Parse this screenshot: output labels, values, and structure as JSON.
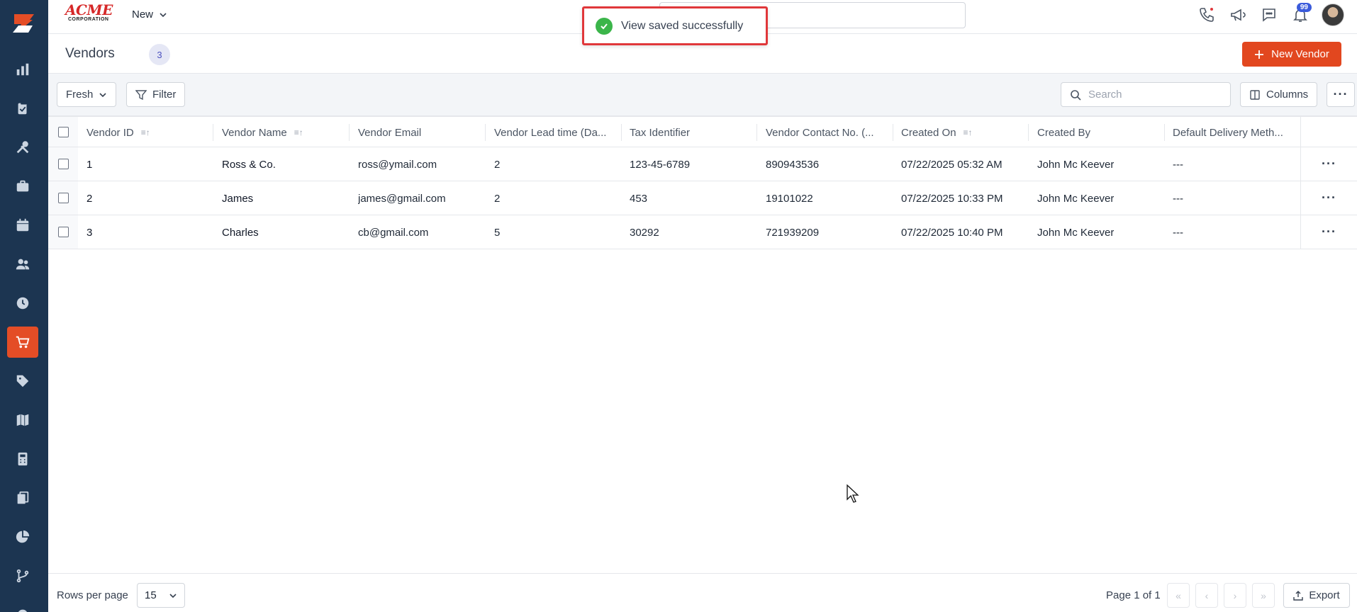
{
  "brand": {
    "name_top": "ACME",
    "name_bottom": "CORPORATION"
  },
  "topbar": {
    "new_label": "New",
    "notification_count": "99"
  },
  "toast": {
    "message": "View saved successfully"
  },
  "page": {
    "title": "Vendors",
    "count": "3",
    "new_button": "New Vendor"
  },
  "toolbar": {
    "view_label": "Fresh",
    "filter_label": "Filter",
    "search_placeholder": "Search",
    "columns_label": "Columns"
  },
  "table": {
    "headers": [
      "Vendor ID",
      "Vendor Name",
      "Vendor Email",
      "Vendor Lead time (Da...",
      "Tax Identifier",
      "Vendor Contact No. (...",
      "Created On",
      "Created By",
      "Default Delivery Meth..."
    ],
    "rows": [
      {
        "id": "1",
        "name": "Ross & Co.",
        "email": "ross@ymail.com",
        "lead": "2",
        "tax": "123-45-6789",
        "contact": "890943536",
        "created_on": "07/22/2025 05:32 AM",
        "created_by": "John Mc Keever",
        "delivery": "---"
      },
      {
        "id": "2",
        "name": "James",
        "email": "james@gmail.com",
        "lead": "2",
        "tax": "453",
        "contact": "19101022",
        "created_on": "07/22/2025 10:33 PM",
        "created_by": "John Mc Keever",
        "delivery": "---"
      },
      {
        "id": "3",
        "name": "Charles",
        "email": "cb@gmail.com",
        "lead": "5",
        "tax": "30292",
        "contact": "721939209",
        "created_on": "07/22/2025 10:40 PM",
        "created_by": "John Mc Keever",
        "delivery": "---"
      }
    ]
  },
  "footer": {
    "rows_per_page_label": "Rows per page",
    "rows_per_page_value": "15",
    "page_info": "Page 1 of 1",
    "export_label": "Export"
  },
  "sidebar": {
    "icons": [
      "reports-icon",
      "clipboard-icon",
      "tools-icon",
      "briefcase-icon",
      "calendar-icon",
      "users-icon",
      "clock-icon",
      "cart-icon",
      "tag-icon",
      "map-icon",
      "calculator-icon",
      "documents-icon",
      "pie-chart-icon",
      "workflow-icon"
    ],
    "active": "cart-icon"
  },
  "colors": {
    "sidebar": "#1c3551",
    "accent": "#e2471f",
    "toast_border": "#e0373a",
    "success": "#3bb54a"
  }
}
